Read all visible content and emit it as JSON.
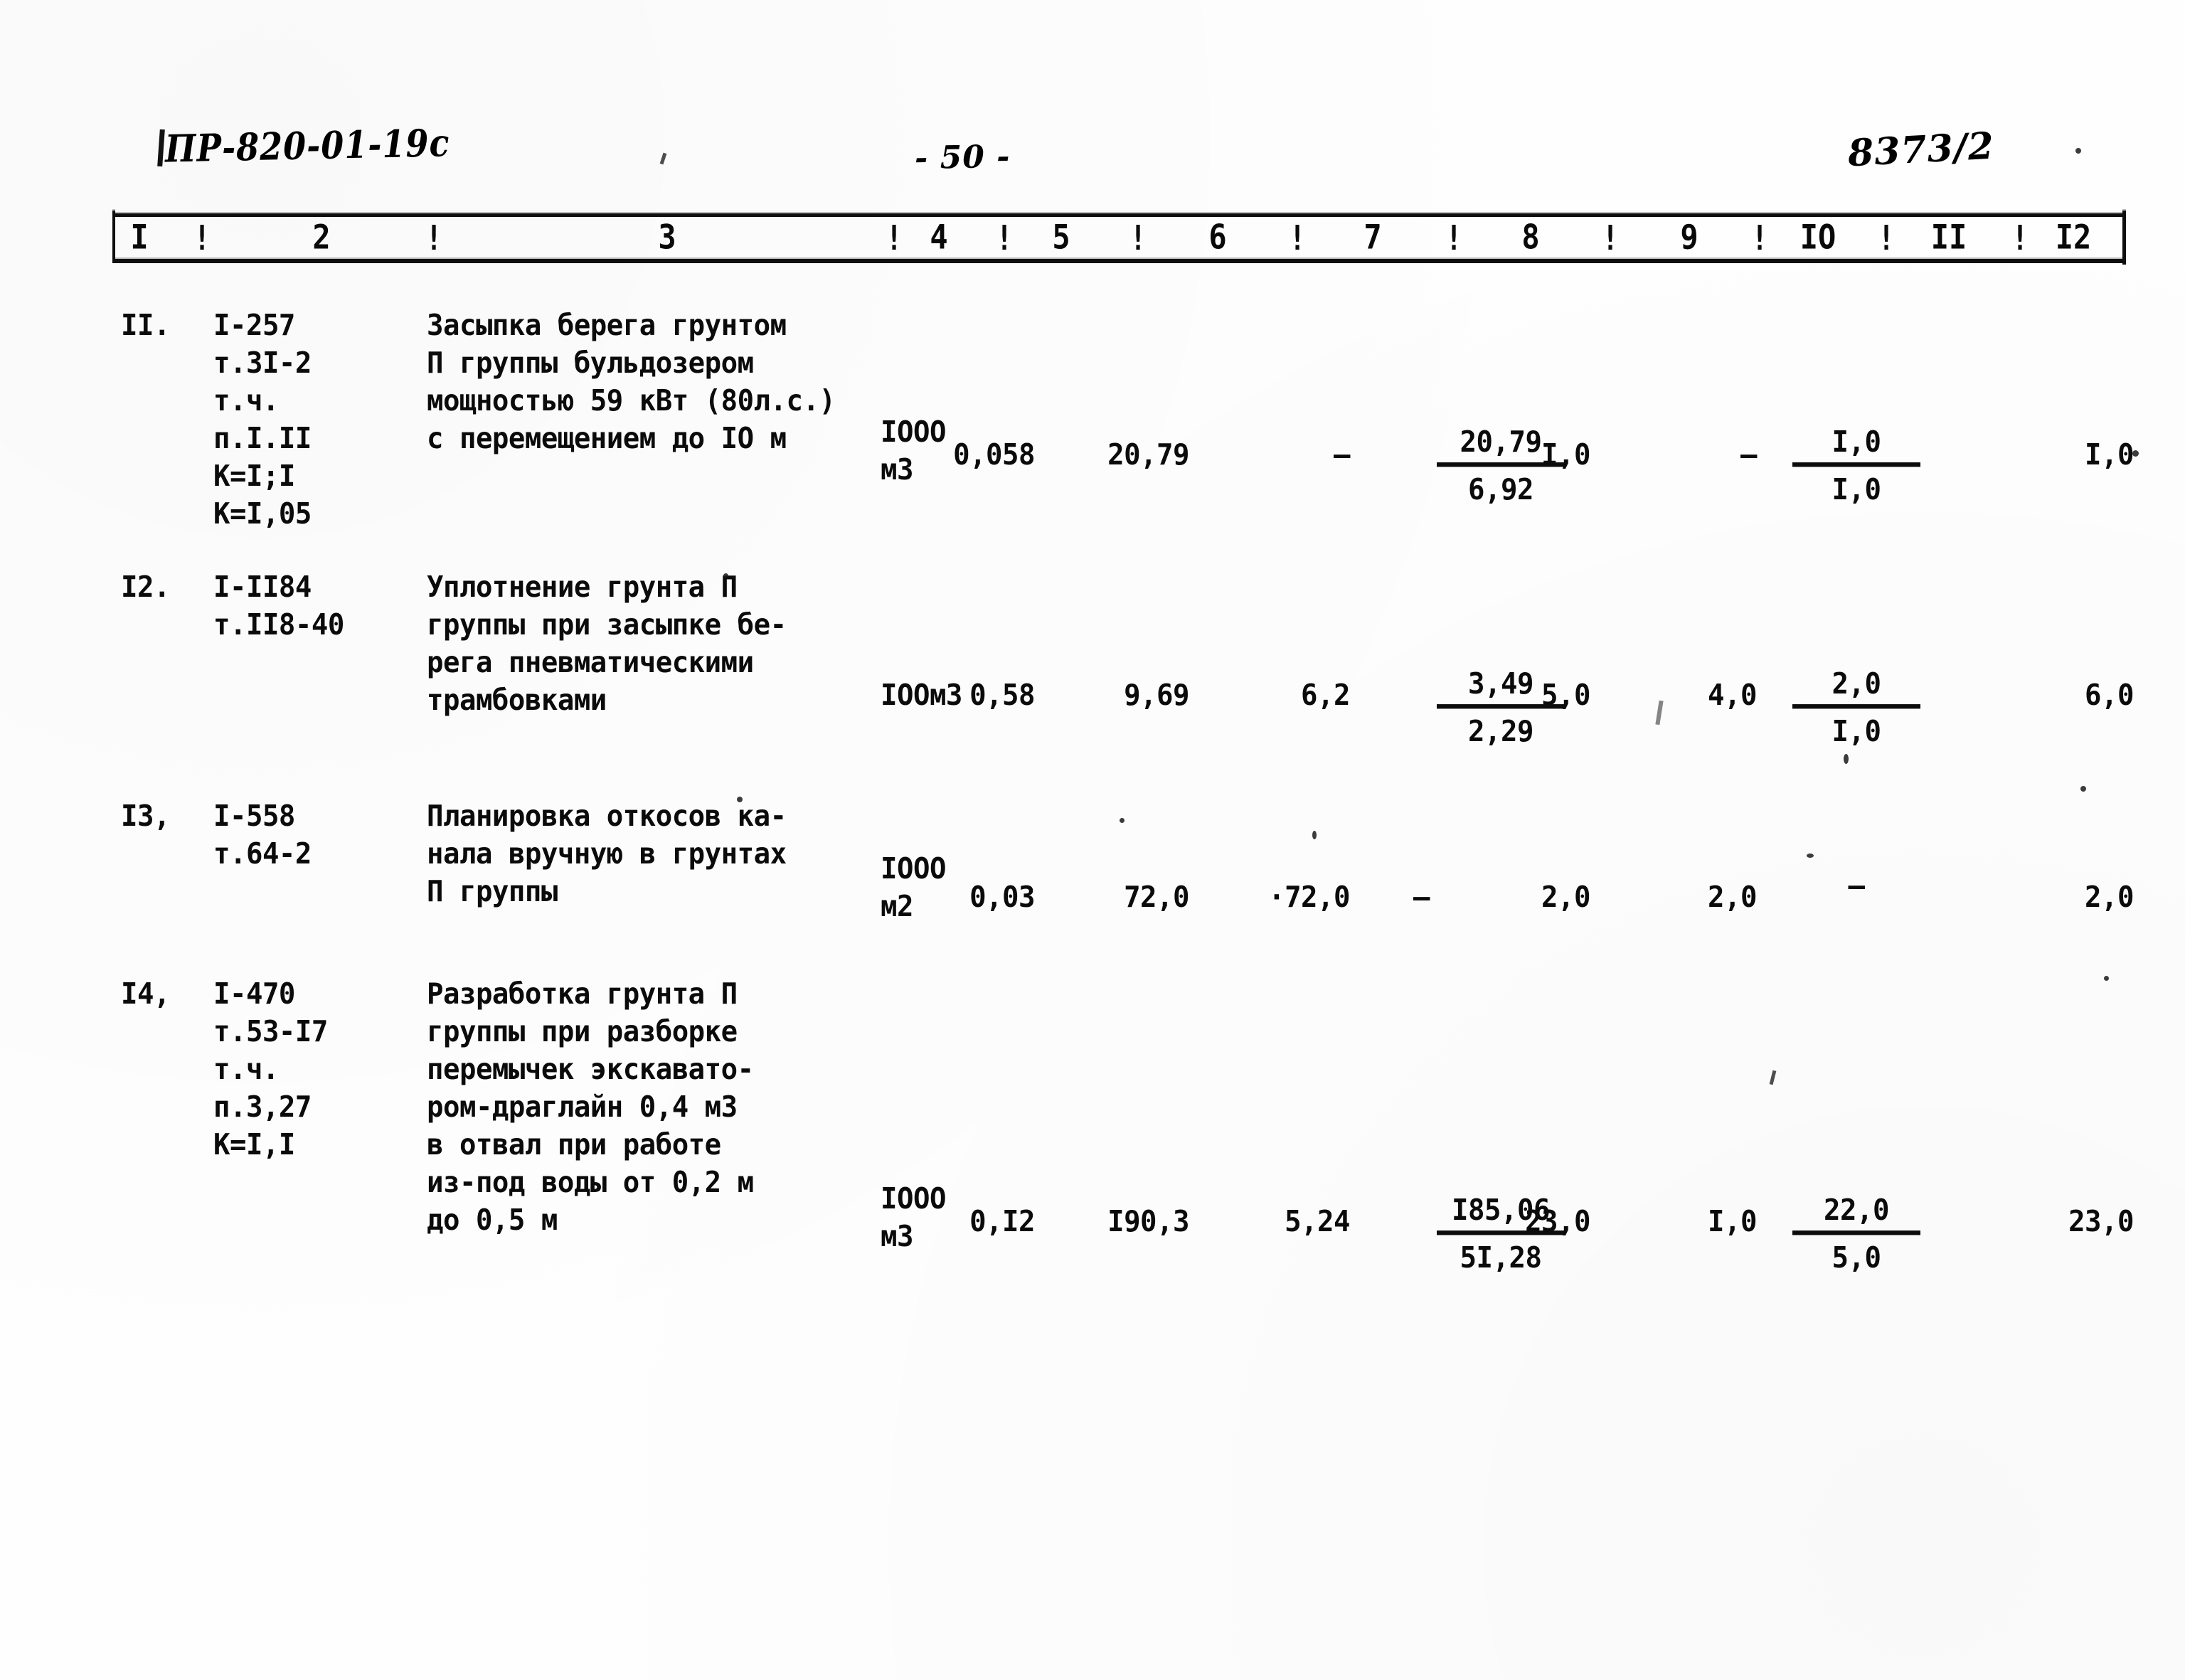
{
  "page": {
    "document_code": "ПР-820-01-19с",
    "page_number": "- 50 -",
    "stamp": "8373/2"
  },
  "table": {
    "column_headers": [
      "I",
      "2",
      "3",
      "4",
      "5",
      "6",
      "7",
      "8",
      "9",
      "IO",
      "II",
      "I2"
    ],
    "separator": "!",
    "rows": [
      {
        "num": "II.",
        "code_lines": [
          "I-257",
          "т.3I-2",
          "т.ч.",
          "п.I.II",
          "К=I;I",
          "К=I,05"
        ],
        "description_lines": [
          "Засыпка берега грунтом",
          "П группы бульдозером",
          "мощностью 59 кВт (80л.с.)",
          "с перемещением до IO м"
        ],
        "unit_lines": [
          "IOOO",
          "м3"
        ],
        "col4": "0,058",
        "col5": "20,79",
        "col6": "–",
        "col7": "",
        "col8_num": "20,79",
        "col8_den": "6,92",
        "col9": "I,0",
        "col10": "–",
        "col11_num": "I,0",
        "col11_den": "I,0",
        "col12": "I,0"
      },
      {
        "num": "I2.",
        "code_lines": [
          "I-II84",
          "т.II8-40"
        ],
        "description_lines": [
          "Уплотнение грунта П",
          "группы при засыпке бе-",
          "рега пневматическими",
          "трамбовками"
        ],
        "unit_lines": [
          "IOOм3"
        ],
        "col4": "0,58",
        "col5": "9,69",
        "col6": "6,2",
        "col7": "",
        "col8_num": "3,49",
        "col8_den": "2,29",
        "col9": "5,0",
        "col10": "4,0",
        "col11_num": "2,0",
        "col11_den": "I,0",
        "col12": "6,0"
      },
      {
        "num": "I3,",
        "code_lines": [
          "I-558",
          "т.64-2"
        ],
        "description_lines": [
          "Планировка откосов ка-",
          "нала вручную в грунтах",
          "П группы"
        ],
        "unit_lines": [
          "IOOO",
          "м2"
        ],
        "col4": "0,03",
        "col5": "72,0",
        "col6": "·72,0",
        "col7": "–",
        "col8_num": "",
        "col8_den": "",
        "col9": "2,0",
        "col10": "2,0",
        "col11_num": "–",
        "col11_den": "",
        "col12": "2,0"
      },
      {
        "num": "I4,",
        "code_lines": [
          "I-470",
          "т.53-I7",
          "т.ч.",
          "п.3,27",
          "К=I,I"
        ],
        "description_lines": [
          "Разработка грунта П",
          "группы при разборке",
          "перемычек экскавато-",
          "ром-драглайн 0,4 м3",
          "в отвал при работе",
          "из-под воды от 0,2 м",
          "до 0,5 м"
        ],
        "unit_lines": [
          "IOOO",
          "м3"
        ],
        "col4": "0,I2",
        "col5": "I90,3",
        "col6": "5,24",
        "col7": "",
        "col8_num": "I85,06",
        "col8_den": "5I,28",
        "col9": "23,0",
        "col10": "I,0",
        "col11_num": "22,0",
        "col11_den": "5,0",
        "col12": "23,0"
      }
    ]
  }
}
